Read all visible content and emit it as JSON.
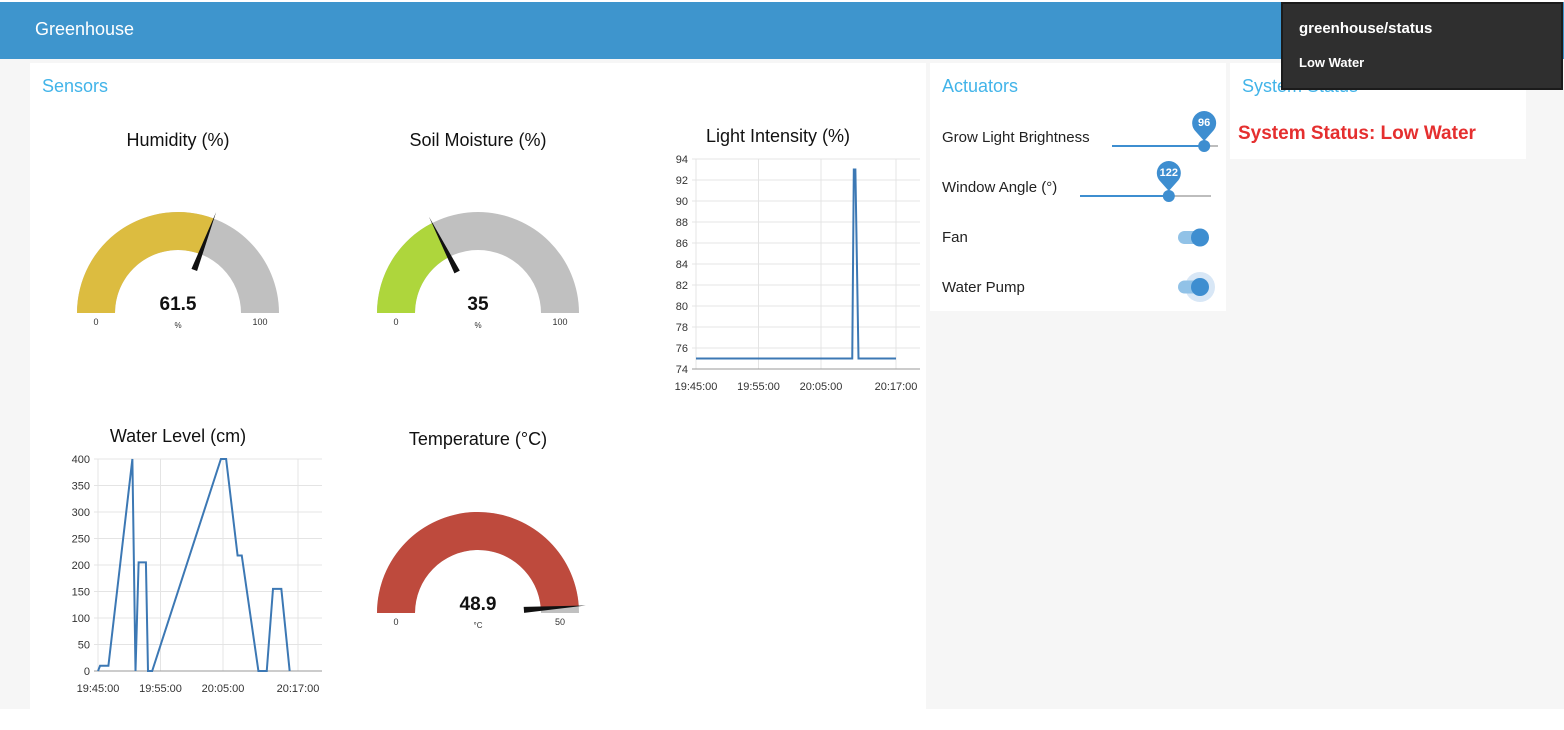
{
  "header": {
    "title": "Greenhouse"
  },
  "colors": {
    "header": "#3e95cd",
    "accent": "#42b4e9",
    "gauge_track": "#c0c0c0",
    "humidity_fill": "#dcbc40",
    "soil_fill": "#aed63c",
    "temp_fill": "#be4a3d",
    "status_red": "#e52f2f",
    "line": "#3c78b4"
  },
  "sensors": {
    "title": "Sensors",
    "humidity": {
      "title": "Humidity (%)",
      "value": 61.5,
      "display": "61.5",
      "unit": "%",
      "min_label": "0",
      "max_label": "100"
    },
    "soil_moisture": {
      "title": "Soil Moisture (%)",
      "value": 35,
      "display": "35",
      "unit": "%",
      "min_label": "0",
      "max_label": "100"
    },
    "temperature": {
      "title": "Temperature (°C)",
      "value": 48.9,
      "display": "48.9",
      "unit": "°C",
      "min_label": "0",
      "max_label": "50"
    }
  },
  "chart_data": [
    {
      "type": "line",
      "title": "Light Intensity (%)",
      "ylim": [
        74,
        94
      ],
      "yticks": [
        "94",
        "92",
        "90",
        "88",
        "86",
        "84",
        "82",
        "80",
        "78",
        "76",
        "74"
      ],
      "xticks": [
        "19:45:00",
        "19:55:00",
        "20:05:00",
        "20:17:00"
      ],
      "grid": true,
      "series": [
        {
          "x": [
            "19:45:00",
            "20:10:00",
            "20:10:15",
            "20:10:30",
            "20:11:00",
            "20:12:00",
            "20:17:00"
          ],
          "values": [
            75,
            75,
            93,
            93,
            75,
            75,
            75
          ]
        }
      ]
    },
    {
      "type": "line",
      "title": "Water Level (cm)",
      "ylim": [
        0,
        400
      ],
      "yticks": [
        "400",
        "350",
        "300",
        "250",
        "200",
        "150",
        "100",
        "50",
        "0"
      ],
      "xticks": [
        "19:45:00",
        "19:55:00",
        "20:05:00",
        "20:17:00"
      ],
      "grid": true,
      "series": [
        {
          "x": [
            "19:45:00",
            "19:45:20",
            "19:46:40",
            "19:50:30",
            "19:51:00",
            "19:51:30",
            "19:52:40",
            "19:53:00",
            "19:53:40",
            "20:04:40",
            "20:05:30",
            "20:07:20",
            "20:08:00",
            "20:10:40",
            "20:12:00",
            "20:13:00",
            "20:14:20",
            "20:15:40"
          ],
          "values": [
            0,
            10,
            10,
            400,
            0,
            205,
            205,
            0,
            0,
            400,
            400,
            218,
            218,
            0,
            0,
            155,
            155,
            0
          ]
        }
      ]
    }
  ],
  "actuators": {
    "title": "Actuators",
    "grow_light": {
      "label": "Grow Light Brightness",
      "value": 96,
      "display": "96",
      "fraction": 0.96
    },
    "window_angle": {
      "label": "Window Angle (°)",
      "value": 122,
      "display": "122",
      "fraction": 0.678
    },
    "fan": {
      "label": "Fan",
      "on": true
    },
    "water_pump": {
      "label": "Water Pump",
      "on": true
    }
  },
  "system": {
    "title": "System Status",
    "status_text": "System Status: Low Water"
  },
  "toast": {
    "topic": "greenhouse/status",
    "message": "Low Water"
  }
}
